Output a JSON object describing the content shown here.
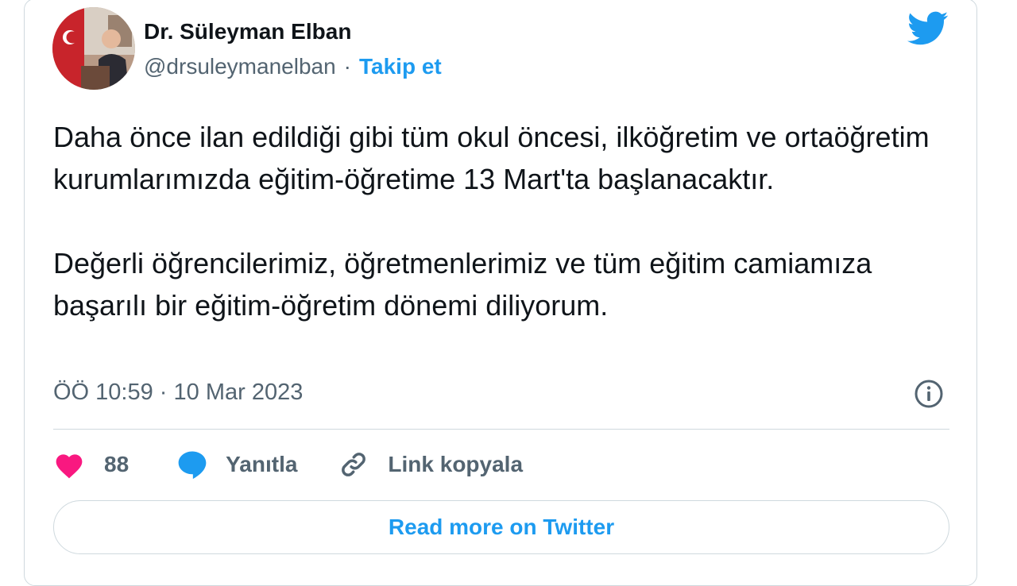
{
  "author": {
    "name": "Dr. Süleyman Elban",
    "handle": "@drsuleymanelban",
    "separator": "·",
    "follow_label": "Takip et",
    "avatar": "avatar-photo"
  },
  "tweet": {
    "paragraphs": [
      "Daha önce ilan edildiği gibi tüm okul öncesi, ilköğretim ve ortaöğretim kurumlarımızda eğitim-öğretime 13 Mart'ta başlanacaktır.",
      "Değerli öğrencilerimiz, öğretmenlerimiz ve tüm eğitim camiamıza başarılı bir eğitim-öğretim dönemi diliyorum."
    ],
    "timestamp": "ÖÖ 10:59 · 10 Mar 2023"
  },
  "actions": {
    "like_count": "88",
    "reply_label": "Yanıtla",
    "copy_link_label": "Link kopyala"
  },
  "read_more_label": "Read more on Twitter",
  "icons": {
    "brand": "twitter-bird-icon",
    "info": "info-icon",
    "like": "heart-icon",
    "reply": "speech-bubble-icon",
    "link": "link-icon"
  },
  "colors": {
    "accent": "#1d9bf0",
    "text": "#0f1419",
    "secondary": "#536471",
    "like": "#f91880",
    "border": "#cfd9de"
  }
}
